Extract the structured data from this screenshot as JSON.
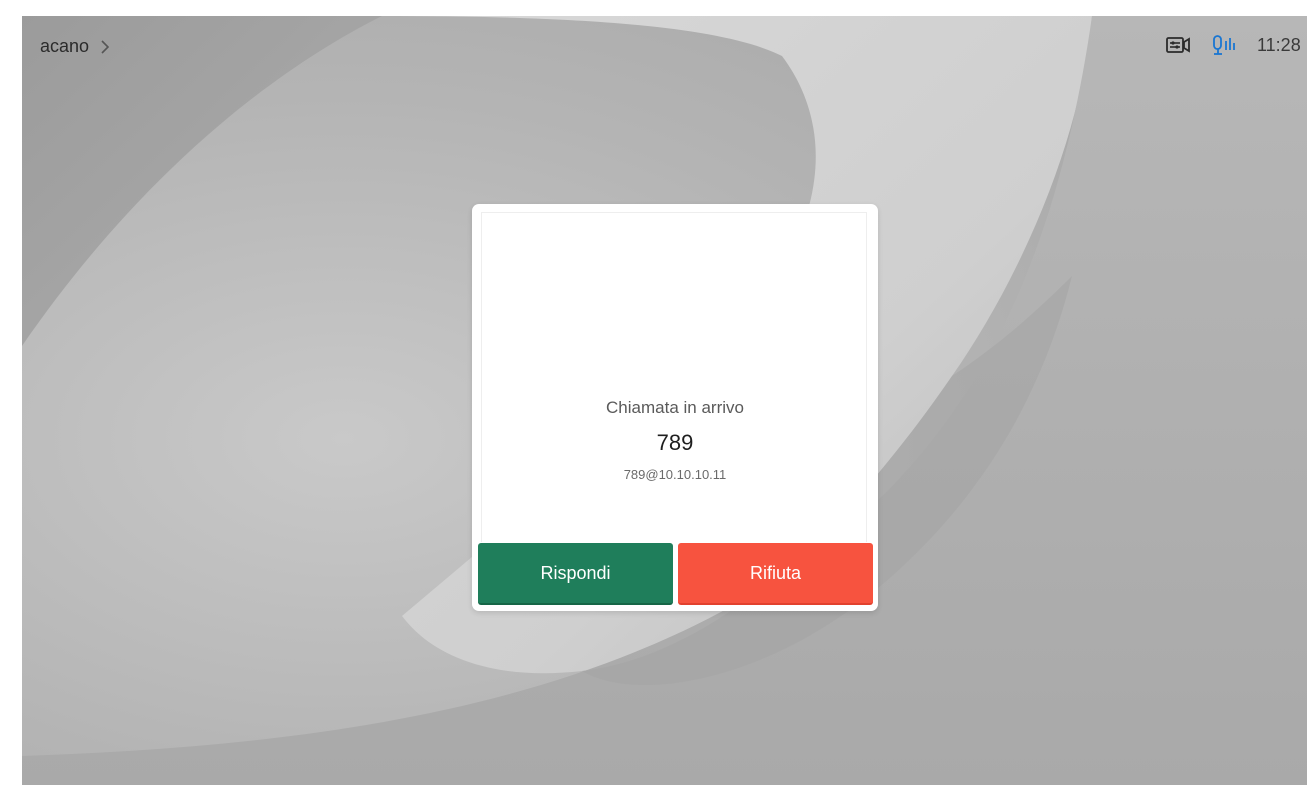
{
  "header": {
    "system_name": "acano",
    "chevron_icon": "chevron-right-icon",
    "status_icons": [
      "camera-controls-icon",
      "microphone-activity-icon"
    ],
    "clock": "11:28",
    "accent_color": "#1976d2"
  },
  "incoming_call": {
    "title": "Chiamata in arrivo",
    "caller_name": "789",
    "caller_uri": "789@10.10.10.11",
    "answer_label": "Rispondi",
    "decline_label": "Rifiuta",
    "answer_color": "#1f7e5b",
    "decline_color": "#f7533f"
  }
}
